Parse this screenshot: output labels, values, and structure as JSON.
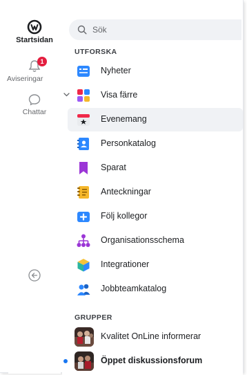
{
  "rail": {
    "home_label": "Startsidan",
    "notifications_label": "Aviseringar",
    "notifications_count": "1",
    "chats_label": "Chattar"
  },
  "search": {
    "placeholder": "Sök"
  },
  "explore": {
    "header": "UTFORSKA",
    "items": [
      {
        "label": "Nyheter",
        "icon": "news-icon"
      },
      {
        "label": "Visa färre",
        "icon": "apps-icon"
      },
      {
        "label": "Evenemang",
        "icon": "calendar-icon"
      },
      {
        "label": "Personkatalog",
        "icon": "contacts-icon"
      },
      {
        "label": "Sparat",
        "icon": "bookmark-icon"
      },
      {
        "label": "Anteckningar",
        "icon": "notebook-icon"
      },
      {
        "label": "Följ kollegor",
        "icon": "follow-icon"
      },
      {
        "label": "Organisationsschema",
        "icon": "org-chart-icon"
      },
      {
        "label": "Integrationer",
        "icon": "cube-icon"
      },
      {
        "label": "Jobbteamkatalog",
        "icon": "team-icon"
      }
    ]
  },
  "groups": {
    "header": "GRUPPER",
    "items": [
      {
        "label": "Kvalitet OnLine informerar"
      },
      {
        "label": "Öppet diskussionsforum"
      }
    ]
  },
  "colors": {
    "accent": "#1877f2",
    "badge": "#e41e3f"
  }
}
